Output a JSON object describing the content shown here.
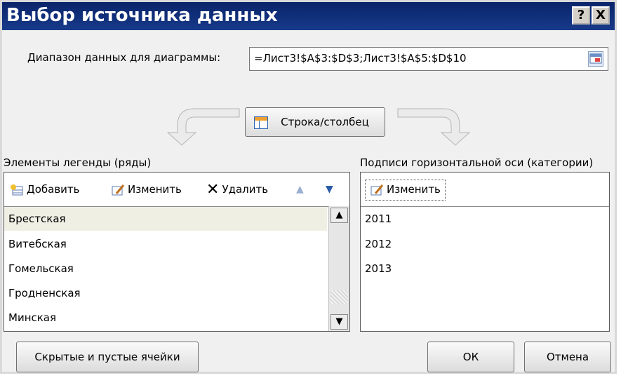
{
  "window": {
    "title": "Выбор источника данных",
    "help_label": "?",
    "close_label": "X"
  },
  "range": {
    "label": "Диапазон данных для диаграммы:",
    "value": "=Лист3!$A$3:$D$3;Лист3!$A$5:$D$10"
  },
  "switch_button": {
    "label": "Строка/столбец"
  },
  "legend": {
    "heading": "Элементы легенды (ряды)",
    "add_label": "Добавить",
    "edit_label": "Изменить",
    "delete_label": "Удалить",
    "items": [
      {
        "label": "Брестская",
        "selected": true
      },
      {
        "label": "Витебская"
      },
      {
        "label": "Гомельская"
      },
      {
        "label": "Гродненская"
      },
      {
        "label": "Минская"
      }
    ]
  },
  "axis": {
    "heading": "Подписи горизонтальной оси (категории)",
    "edit_label": "Изменить",
    "items": [
      "2011",
      "2012",
      "2013"
    ]
  },
  "footer": {
    "hidden_cells_label": "Скрытые и пустые ячейки",
    "ok_label": "ОК",
    "cancel_label": "Отмена"
  },
  "colors": {
    "titlebar": "#0a246a",
    "dialog_bg": "#f0f0f0",
    "selection": "#efefe4"
  }
}
